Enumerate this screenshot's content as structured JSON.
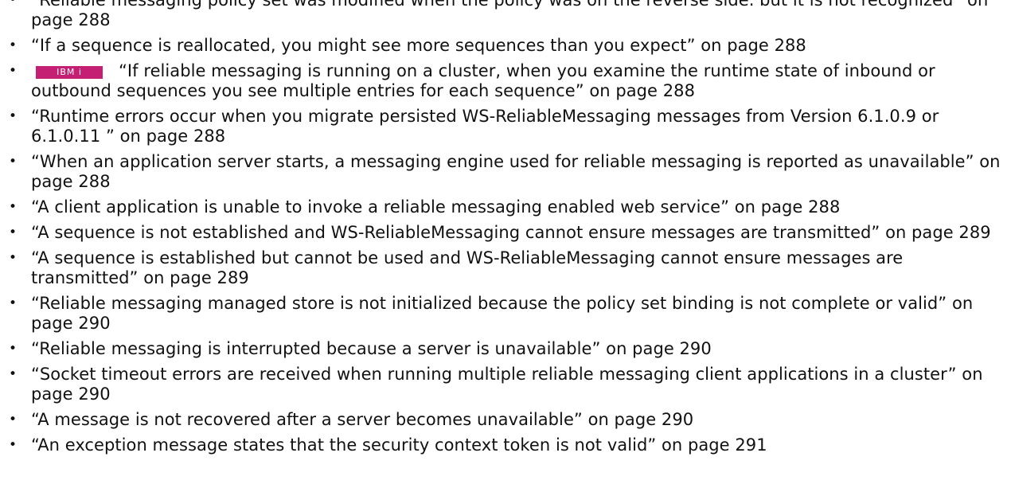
{
  "bullet_char": "•",
  "badge_color": "#c51f73",
  "items": [
    {
      "text": "“Reliable messaging policy set was modified when the policy was on the reverse side. but it is not recognized” on page 288"
    },
    {
      "text": "“If a sequence is reallocated, you might see more sequences than you expect” on page 288"
    },
    {
      "badge": "IBM i",
      "text": "“If reliable messaging is running on a cluster, when you examine the runtime state of inbound or outbound sequences you see multiple entries for each sequence” on page 288"
    },
    {
      "text": "“Runtime errors occur when you migrate persisted WS-ReliableMessaging messages from Version 6.1.0.9 or 6.1.0.11 ” on page 288"
    },
    {
      "text": "“When an application server starts, a messaging engine used for reliable messaging is reported as unavailable” on page 288"
    },
    {
      "text": "“A client application is unable to invoke a reliable messaging enabled web service” on page 288"
    },
    {
      "text": "“A sequence is not established and WS-ReliableMessaging cannot ensure messages are transmitted” on page 289"
    },
    {
      "text": "“A sequence is established but cannot be used and WS-ReliableMessaging cannot ensure messages are transmitted” on page 289"
    },
    {
      "text": "“Reliable messaging managed store is not initialized because the policy set binding is not complete or valid” on page 290"
    },
    {
      "text": "“Reliable messaging is interrupted because a server is unavailable” on page 290"
    },
    {
      "text": "“Socket timeout errors are received when running multiple reliable messaging client applications in a cluster” on page 290"
    },
    {
      "text": "“A message is not recovered after a server becomes unavailable” on page 290"
    },
    {
      "text": "“An exception message states that the security context token is not valid” on page 291"
    }
  ]
}
